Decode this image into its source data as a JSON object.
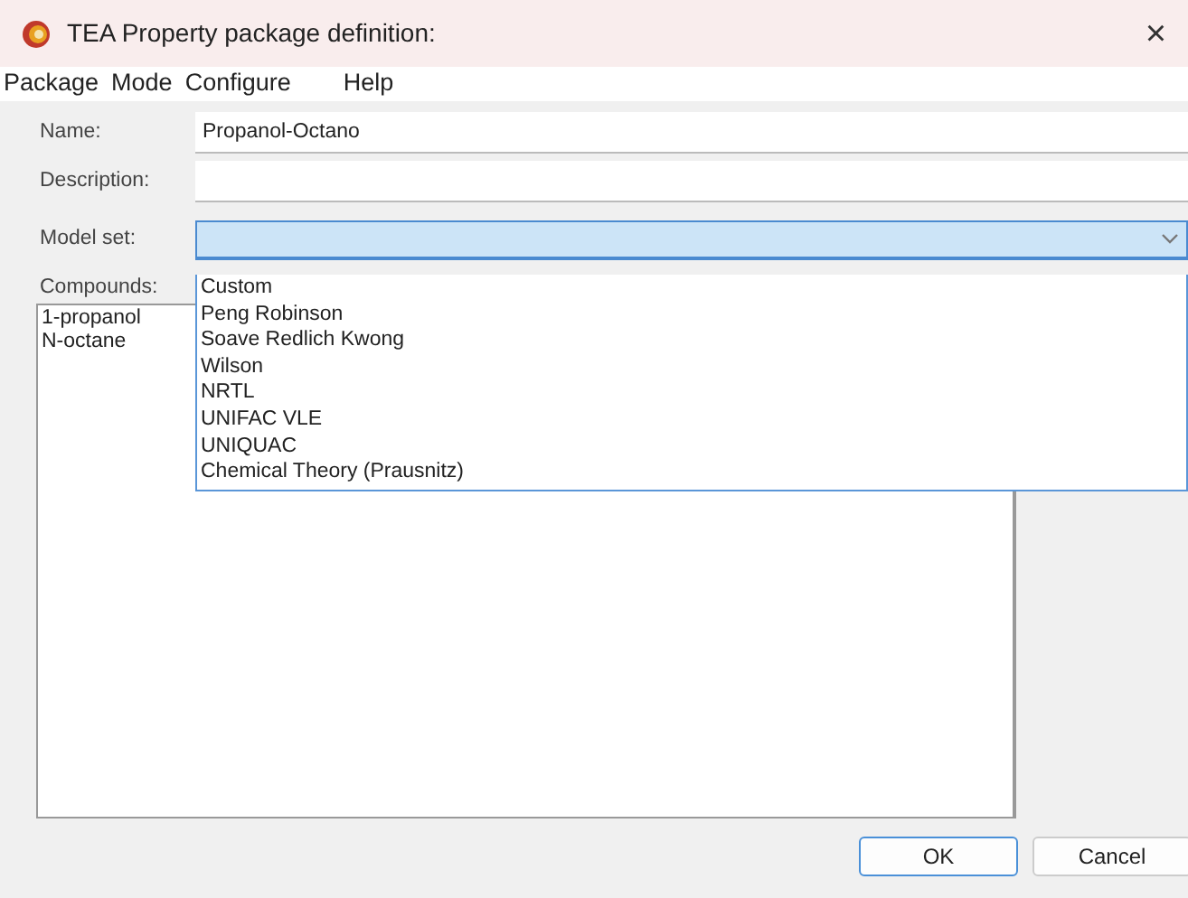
{
  "window": {
    "title": "TEA Property package definition:",
    "close": "×"
  },
  "menu": [
    "Package",
    "Mode",
    "Configure",
    "Help"
  ],
  "fields": [
    {
      "label": "Name:",
      "value": "Propanol-Octano"
    },
    {
      "label": "Description:"
    }
  ],
  "model_set": {
    "label": "Model set:",
    "expanded": true,
    "options": [
      "Custom",
      "Peng Robinson",
      "Soave Redlich Kwong",
      "Wilson",
      "NRTL",
      "UNIFAC VLE",
      "UNIQUAC",
      "Chemical Theory (Prausnitz)"
    ]
  },
  "compounds": {
    "label": "Compounds:",
    "items": [
      "1-propanol",
      "N-octane"
    ]
  },
  "buttons": [
    {
      "label": "OK",
      "default": true
    },
    {
      "label": "Cancel",
      "default": false
    }
  ]
}
